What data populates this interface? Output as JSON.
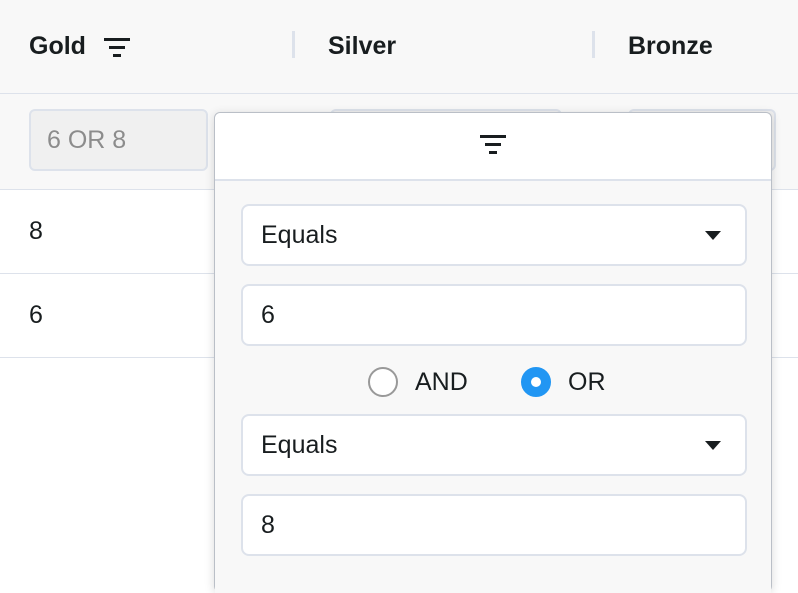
{
  "columns": [
    {
      "label": "Gold",
      "has_filter_icon": true
    },
    {
      "label": "Silver"
    },
    {
      "label": "Bronze"
    }
  ],
  "floating_filter": {
    "gold_value": "6 OR 8"
  },
  "rows": [
    {
      "gold": "8"
    },
    {
      "gold": "6"
    }
  ],
  "filter_popup": {
    "header_icon": "filter-icon",
    "condition1": {
      "operator": "Equals",
      "value": "6"
    },
    "join": {
      "and_label": "AND",
      "or_label": "OR",
      "selected": "OR"
    },
    "condition2": {
      "operator": "Equals",
      "value": "8"
    }
  },
  "colors": {
    "accent": "#2196f3",
    "border": "#dde2eb",
    "header_bg": "#f8f8f8"
  }
}
